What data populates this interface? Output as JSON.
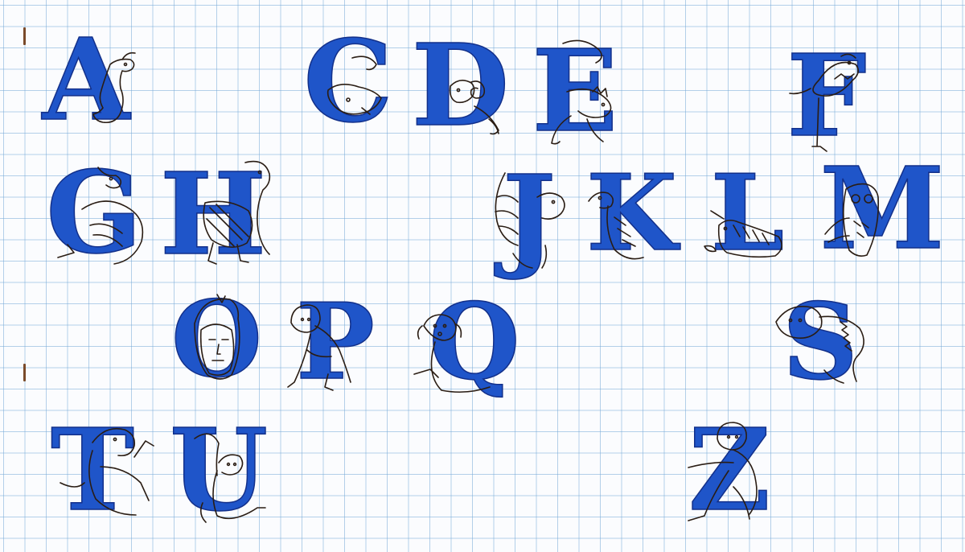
{
  "page": {
    "background_color": "#fbfcfe",
    "grid_color": "#78aad7",
    "ink_blue": "#1f55c9",
    "ink_outline": "#2a1d14"
  },
  "letters": [
    {
      "id": "a",
      "letter": "A",
      "creature": "hare-icon"
    },
    {
      "id": "c",
      "letter": "C",
      "creature": "boar-head-icon"
    },
    {
      "id": "d",
      "letter": "D",
      "creature": "ram-icon"
    },
    {
      "id": "e",
      "letter": "E",
      "creature": "dragon-icon"
    },
    {
      "id": "f",
      "letter": "F",
      "creature": "bird-icon"
    },
    {
      "id": "g",
      "letter": "G",
      "creature": "griffin-icon"
    },
    {
      "id": "h",
      "letter": "H",
      "creature": "eagle-icon"
    },
    {
      "id": "j",
      "letter": "J",
      "creature": "winged-beast-icon"
    },
    {
      "id": "k",
      "letter": "K",
      "creature": "bird-icon"
    },
    {
      "id": "l",
      "letter": "L",
      "creature": "unicorn-icon"
    },
    {
      "id": "m",
      "letter": "M",
      "creature": "owl-icon"
    },
    {
      "id": "o",
      "letter": "O",
      "creature": "hooded-face-icon"
    },
    {
      "id": "p",
      "letter": "P",
      "creature": "crouching-figure-icon"
    },
    {
      "id": "q",
      "letter": "Q",
      "creature": "dog-icon"
    },
    {
      "id": "s",
      "letter": "S",
      "creature": "lion-icon"
    },
    {
      "id": "t",
      "letter": "T",
      "creature": "wolf-icon"
    },
    {
      "id": "u",
      "letter": "U",
      "creature": "cat-icon"
    },
    {
      "id": "z",
      "letter": "Z",
      "creature": "kneeling-figure-icon"
    }
  ]
}
